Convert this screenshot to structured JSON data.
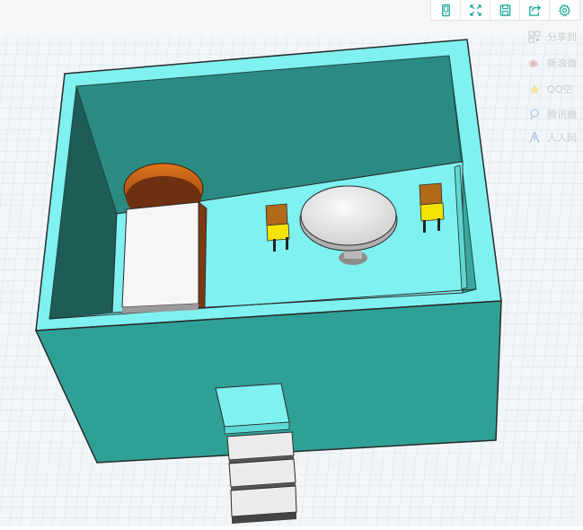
{
  "toolbar": {
    "buttons": [
      {
        "icon": "mobile-icon"
      },
      {
        "icon": "fullscreen-icon"
      },
      {
        "icon": "save-icon"
      },
      {
        "icon": "share-icon"
      },
      {
        "icon": "gear-icon"
      }
    ]
  },
  "share_menu": {
    "items": [
      {
        "label": "分享到",
        "icon": "qr-code-icon"
      },
      {
        "label": "新浪微",
        "icon": "weibo-icon"
      },
      {
        "label": "QQ空",
        "icon": "qzone-icon"
      },
      {
        "label": "腾讯微",
        "icon": "tencent-weibo-icon"
      },
      {
        "label": "人人网",
        "icon": "renren-icon"
      }
    ]
  },
  "colors": {
    "accent": "#1aa79b",
    "wall_outer": "#2e8f87",
    "wall_top": "#7ff1f1",
    "floor": "#7ff1f1",
    "grid_bg": "#f2f6f8",
    "grid_line": "#bfe1f4"
  }
}
